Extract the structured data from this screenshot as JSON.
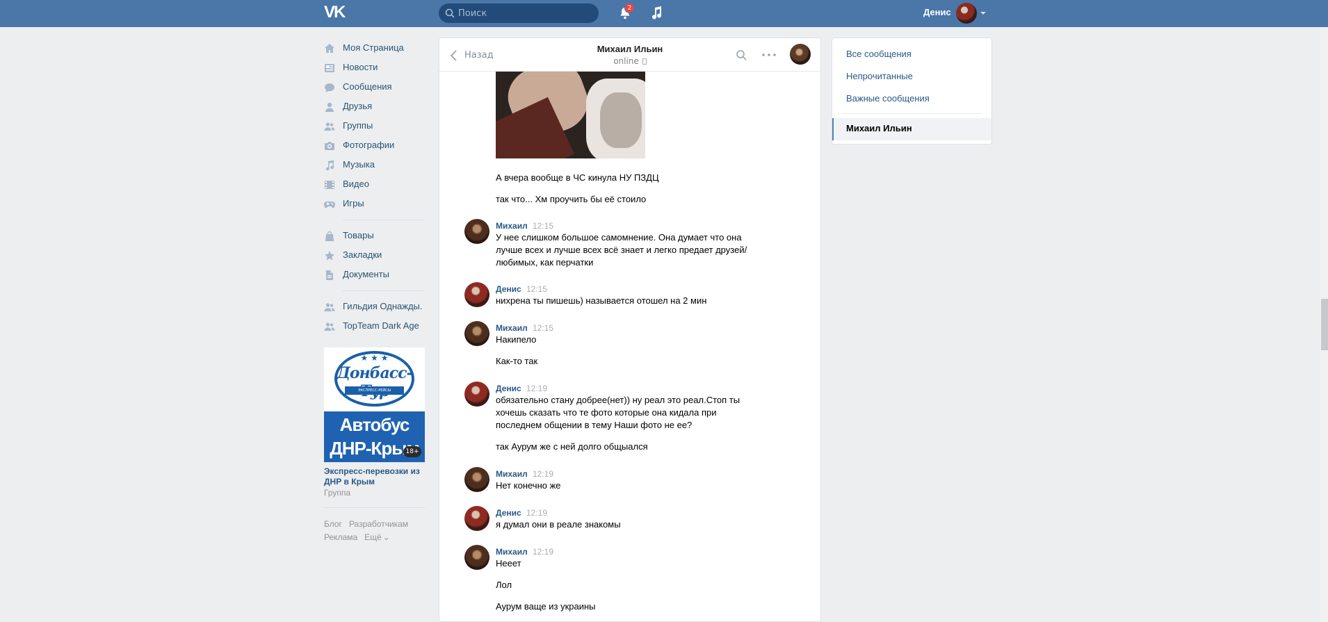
{
  "header": {
    "logo_text": "VK",
    "search_placeholder": "Поиск",
    "notifications_count": "2",
    "user_name": "Денис"
  },
  "sidebar": {
    "items": [
      {
        "label": "Моя Страница",
        "icon": "user-home-icon"
      },
      {
        "label": "Новости",
        "icon": "news-icon"
      },
      {
        "label": "Сообщения",
        "icon": "messages-icon"
      },
      {
        "label": "Друзья",
        "icon": "friends-icon"
      },
      {
        "label": "Группы",
        "icon": "groups-icon"
      },
      {
        "label": "Фотографии",
        "icon": "camera-icon"
      },
      {
        "label": "Музыка",
        "icon": "music-icon"
      },
      {
        "label": "Видео",
        "icon": "video-icon"
      },
      {
        "label": "Игры",
        "icon": "gamepad-icon"
      }
    ],
    "items2": [
      {
        "label": "Товары",
        "icon": "bag-icon"
      },
      {
        "label": "Закладки",
        "icon": "star-icon"
      },
      {
        "label": "Документы",
        "icon": "document-icon"
      }
    ],
    "items3": [
      {
        "label": "Гильдия Однажды.",
        "icon": "group-icon"
      },
      {
        "label": "TopTeam Dark Age",
        "icon": "group-icon"
      }
    ]
  },
  "ad": {
    "logo": "Донбасс-Тур",
    "ribbon": "ЭКСПРЕСС-РЕЙСЫ",
    "line1": "Автобус",
    "line2": "ДНР-Крым",
    "age": "18+",
    "title": "Экспресс-перевозки из ДНР в Крым",
    "subtitle": "Группа"
  },
  "footer": {
    "links": [
      "Блог",
      "Разработчикам",
      "Реклама",
      "Ещё"
    ]
  },
  "chat": {
    "back_label": "Назад",
    "title": "Михаил Ильин",
    "status": "online",
    "messages": [
      {
        "text": "А вчера вообще в ЧС кинула НУ ПЗДЦ"
      },
      {
        "text": "так что... Хм проучить бы её стоило"
      },
      {
        "author": "Михаил",
        "time": "12:15",
        "text": "У нее слишком большое самомнение. Она думает что она лучше всех и лучше всех всё знает и легко предает друзей/любимых, как перчатки"
      },
      {
        "author": "Денис",
        "time": "12:15",
        "text": "нихрена ты пишешь) называется отошел на 2 мин"
      },
      {
        "author": "Михаил",
        "time": "12:15",
        "text": "Накипело"
      },
      {
        "text": "Как-то так"
      },
      {
        "author": "Денис",
        "time": "12:19",
        "text": "обязательно стану добрее(нет)) ну реал это реал.Стоп ты хочешь сказать что те фото которые она кидала при последнем общении в тему Наши фото не ее?"
      },
      {
        "text": "так Аурум же с ней долго общыался"
      },
      {
        "author": "Михаил",
        "time": "12:19",
        "text": "Нет конечно же"
      },
      {
        "author": "Денис",
        "time": "12:19",
        "text": "я думал они в реале знакомы"
      },
      {
        "author": "Михаил",
        "time": "12:19",
        "text": "Нееет"
      },
      {
        "text": "Лол"
      },
      {
        "text": "Аурум ваще из украины"
      }
    ]
  },
  "right_panel": {
    "items": [
      "Все сообщения",
      "Непрочитанные",
      "Важные сообщения"
    ],
    "active": "Михаил Ильин"
  },
  "colors": {
    "header_bg": "#4a76a8",
    "page_bg": "#edeef0",
    "link": "#2a5885",
    "badge": "#e64646"
  }
}
